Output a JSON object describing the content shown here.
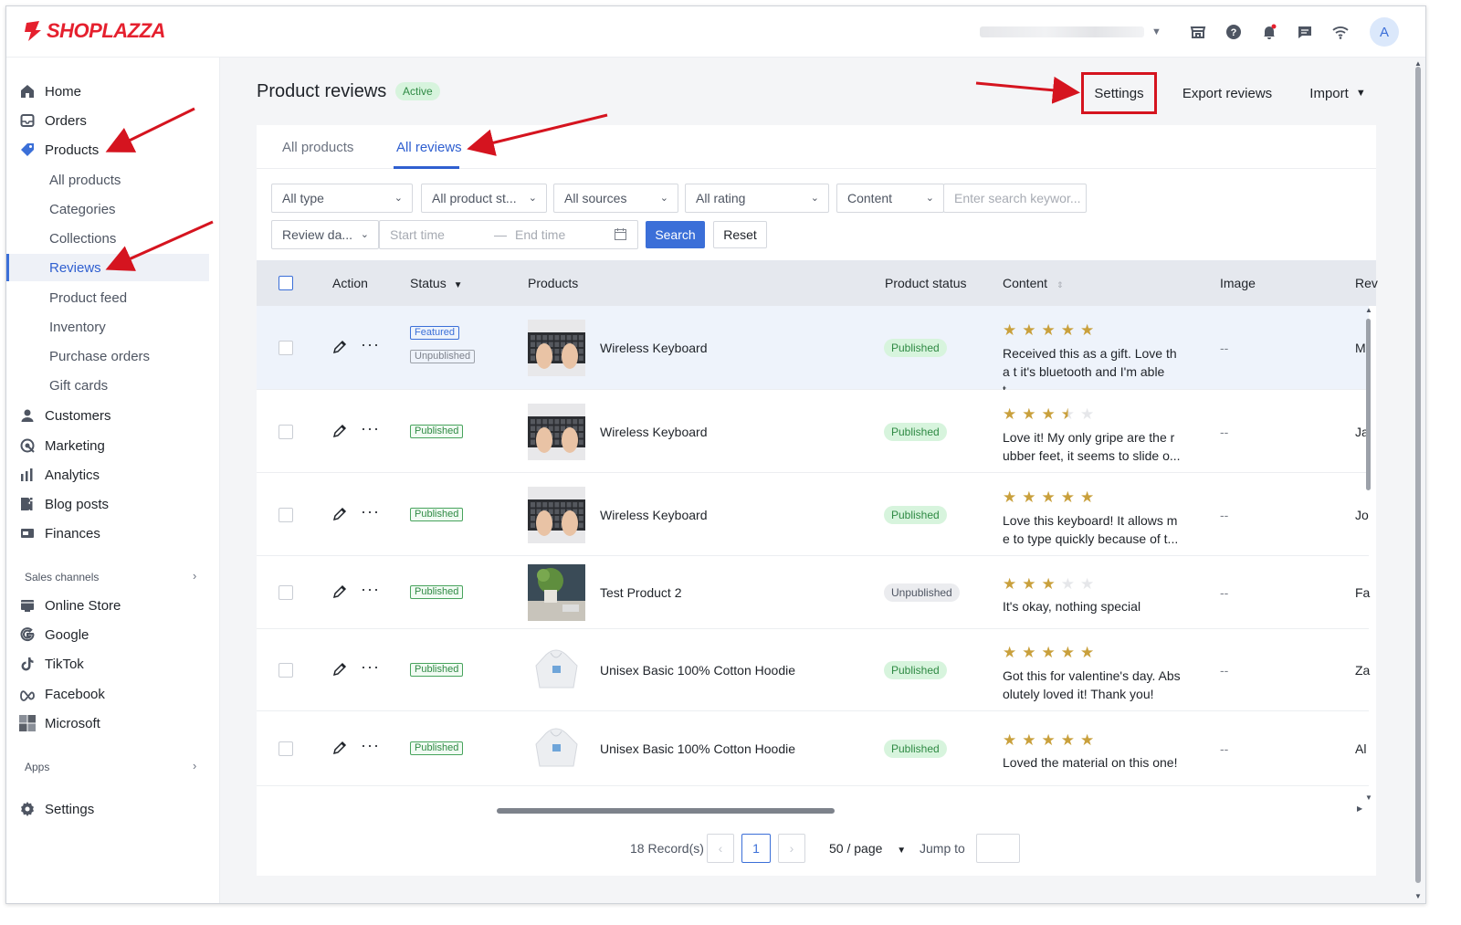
{
  "brand": {
    "name": "SHOPLAZZA",
    "accent": "#e5202e",
    "primary": "#3b6fd8"
  },
  "topbar": {
    "avatar_initial": "A",
    "icons": [
      "store-icon",
      "help-icon",
      "bell-icon",
      "chat-icon",
      "wifi-icon"
    ]
  },
  "sidebar": {
    "main": [
      {
        "label": "Home",
        "icon": "home-icon"
      },
      {
        "label": "Orders",
        "icon": "orders-icon"
      },
      {
        "label": "Products",
        "icon": "tag-icon"
      }
    ],
    "products_sub": [
      "All products",
      "Categories",
      "Collections",
      "Reviews",
      "Product feed",
      "Inventory",
      "Purchase orders",
      "Gift cards"
    ],
    "more": [
      {
        "label": "Customers",
        "icon": "person-icon"
      },
      {
        "label": "Marketing",
        "icon": "marketing-icon"
      },
      {
        "label": "Analytics",
        "icon": "analytics-icon"
      },
      {
        "label": "Blog posts",
        "icon": "blog-icon"
      },
      {
        "label": "Finances",
        "icon": "finances-icon"
      }
    ],
    "sales_channels_label": "Sales channels",
    "channels": [
      {
        "label": "Online Store",
        "icon": "store-icon"
      },
      {
        "label": "Google",
        "icon": "google-icon"
      },
      {
        "label": "TikTok",
        "icon": "tiktok-icon"
      },
      {
        "label": "Facebook",
        "icon": "meta-icon"
      },
      {
        "label": "Microsoft",
        "icon": "microsoft-icon"
      }
    ],
    "apps_label": "Apps",
    "settings_label": "Settings"
  },
  "page": {
    "title": "Product reviews",
    "status_badge": "Active",
    "actions": {
      "settings": "Settings",
      "export": "Export reviews",
      "import": "Import"
    }
  },
  "tabs": [
    "All products",
    "All reviews"
  ],
  "filters": {
    "type": "All type",
    "product_status": "All product st...",
    "sources": "All sources",
    "rating": "All rating",
    "content": "Content",
    "search_placeholder": "Enter search keywor...",
    "review_date": "Review da...",
    "start_placeholder": "Start time",
    "end_placeholder": "End time",
    "search_btn": "Search",
    "reset_btn": "Reset"
  },
  "table": {
    "columns": [
      "Action",
      "Status",
      "Products",
      "Product status",
      "Content",
      "Image",
      "Rev"
    ],
    "rows": [
      {
        "tags": [
          "Featured",
          "Unpublished"
        ],
        "product": "Wireless Keyboard",
        "img": "keyboard",
        "product_status": "Published",
        "rating": 5,
        "content": "Received this as a gift. Love tha t it's bluetooth and I'm able t...",
        "image": "--",
        "reviewer": "M"
      },
      {
        "tags": [
          "Published"
        ],
        "product": "Wireless Keyboard",
        "img": "keyboard",
        "product_status": "Published",
        "rating": 3.5,
        "content": "Love it! My only gripe are the r ubber feet, it seems to slide o...",
        "image": "--",
        "reviewer": "Ja"
      },
      {
        "tags": [
          "Published"
        ],
        "product": "Wireless Keyboard",
        "img": "keyboard",
        "product_status": "Published",
        "rating": 5,
        "content": "Love this keyboard! It allows m e to type quickly because of t...",
        "image": "--",
        "reviewer": "Jo"
      },
      {
        "tags": [
          "Published"
        ],
        "product": "Test Product 2",
        "img": "plant",
        "product_status": "Unpublished",
        "rating": 3,
        "content": "It's okay, nothing special",
        "image": "--",
        "reviewer": "Fa"
      },
      {
        "tags": [
          "Published"
        ],
        "product": "Unisex Basic 100% Cotton Hoodie",
        "img": "hoodie",
        "product_status": "Published",
        "rating": 5,
        "content": "Got this for valentine's day. Abs olutely loved it! Thank you!",
        "image": "--",
        "reviewer": "Za"
      },
      {
        "tags": [
          "Published"
        ],
        "product": "Unisex Basic 100% Cotton Hoodie",
        "img": "hoodie",
        "product_status": "Published",
        "rating": 5,
        "content": "Loved the material on this one!",
        "image": "--",
        "reviewer": "Al"
      }
    ]
  },
  "pagination": {
    "records": "18 Record(s)",
    "current_page": "1",
    "page_size": "50 / page",
    "jump_label": "Jump to"
  }
}
